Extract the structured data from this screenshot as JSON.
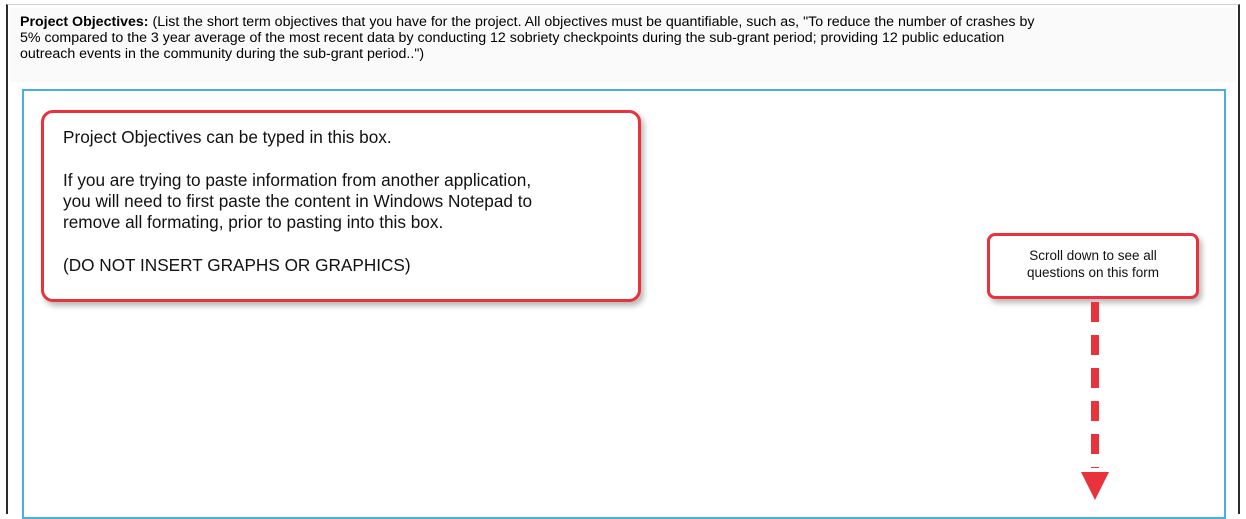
{
  "objectives": {
    "label": "Project Objectives:",
    "description_line1": " (List the short term objectives that you have for the project.  All objectives must be quantifiable, such as, \"To reduce the number of crashes by",
    "description_line2": "5% compared to the 3 year average of the most recent data by conducting 12 sobriety checkpoints during the sub-grant period; providing 12 public education",
    "description_line3": "outreach events in the community during the sub-grant period..\")",
    "textarea_value": ""
  },
  "callout_main": {
    "line1": "Project Objectives can be typed in this box.",
    "para2_line1": "If you are trying to paste information from another application,",
    "para2_line2": "you will need to first paste the content in Windows Notepad to",
    "para2_line3": "remove all formating, prior to pasting into this box.",
    "line4": "(DO NOT INSERT GRAPHS OR GRAPHICS)"
  },
  "callout_scroll": {
    "line1": "Scroll down to see all",
    "line2": "questions on this form"
  },
  "colors": {
    "callout_border": "#e8323c",
    "textarea_border": "#49aee0",
    "arrow": "#e8323c"
  },
  "icons": {
    "scroll_arrow": "dashed-down-arrow-icon"
  }
}
